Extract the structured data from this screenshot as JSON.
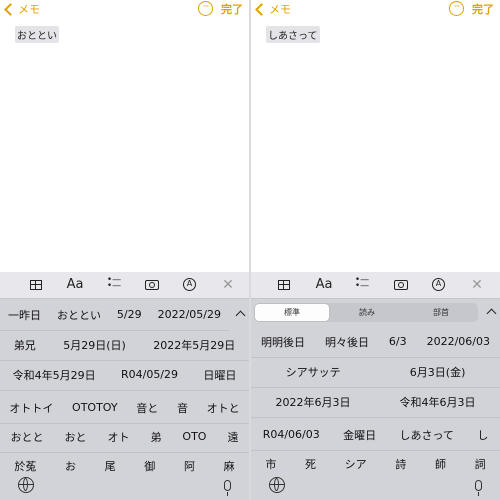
{
  "left": {
    "back_label": "メモ",
    "done_label": "完了",
    "note_text": "おととい",
    "candidate_rows": [
      [
        "一昨日",
        "おととい",
        "5/29",
        "2022/05/29"
      ],
      [
        "弟兄",
        "5月29日(日)",
        "2022年5月29日"
      ],
      [
        "令和4年5月29日",
        "R04/05/29",
        "日曜日"
      ],
      [
        "オトトイ",
        "OTOTOY",
        "音と",
        "音",
        "オトと"
      ],
      [
        "おとと",
        "おと",
        "オト",
        "弟",
        "OTO",
        "遠"
      ],
      [
        "於菟",
        "お",
        "尾",
        "御",
        "阿",
        "麻"
      ]
    ]
  },
  "right": {
    "back_label": "メモ",
    "done_label": "完了",
    "note_text": "しあさって",
    "segments": [
      "標準",
      "読み",
      "部首"
    ],
    "selected_segment": 0,
    "candidate_rows": [
      [
        "明明後日",
        "明々後日",
        "6/3",
        "2022/06/03"
      ],
      [
        "シアサッテ",
        "6月3日(金)"
      ],
      [
        "2022年6月3日",
        "令和4年6月3日"
      ],
      [
        "R04/06/03",
        "金曜日",
        "しあさって",
        "し"
      ],
      [
        "市",
        "死",
        "シア",
        "詩",
        "師",
        "詞"
      ]
    ]
  },
  "toolbar_icons": [
    "table-icon",
    "text-format-icon",
    "checklist-icon",
    "camera-icon",
    "markup-pen-icon",
    "close-icon"
  ],
  "toolbar_text": {
    "format": "Aa",
    "close": "✕"
  },
  "colors": {
    "accent": "#e1a200",
    "keyboard_bg": "#d2d3d9",
    "toolbar_bg": "#e8e8ec"
  }
}
